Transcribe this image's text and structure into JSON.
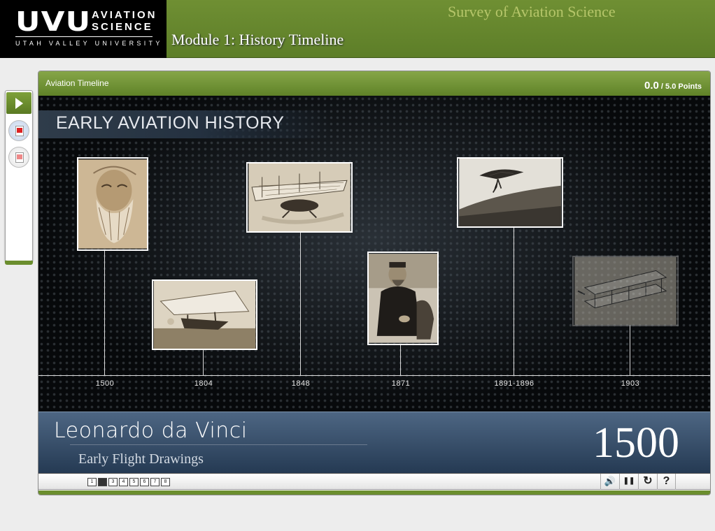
{
  "header": {
    "logo_mark": "UVU",
    "logo_line1": "AVIATION",
    "logo_line2": "SCIENCE",
    "logo_university": "UTAH VALLEY UNIVERSITY",
    "course_title": "Survey of Aviation Science",
    "module_title": "Module 1: History Timeline"
  },
  "sidebar": {
    "items": [
      {
        "icon": "play-icon",
        "state": "default"
      },
      {
        "icon": "pdf-document-icon",
        "state": "active"
      },
      {
        "icon": "pdf-document-icon",
        "state": "inactive"
      }
    ]
  },
  "panel": {
    "title": "Aviation Timeline",
    "score": "0.0",
    "score_total": "/ 5.0 Points"
  },
  "stage": {
    "section_title": "EARLY AVIATION HISTORY",
    "events": [
      {
        "year": "1500",
        "image": "Leonardo da Vinci portrait sketch"
      },
      {
        "year": "1804",
        "image": "early glider photograph"
      },
      {
        "year": "1848",
        "image": "steam-powered aircraft illustration"
      },
      {
        "year": "1871",
        "image": "portrait of seated bearded man"
      },
      {
        "year": "1891-1896",
        "image": "hang glider in flight"
      },
      {
        "year": "1903",
        "image": "biplane glider"
      }
    ]
  },
  "caption": {
    "name": "Leonardo da Vinci",
    "subtitle": "Early Flight Drawings",
    "year": "1500"
  },
  "controls": {
    "pages": [
      "1",
      "2",
      "3",
      "4",
      "5",
      "6",
      "7",
      "8"
    ],
    "current_page": 2,
    "buttons": [
      {
        "name": "volume-icon",
        "glyph": "🔊"
      },
      {
        "name": "pause-icon",
        "glyph": "❚❚"
      },
      {
        "name": "replay-icon",
        "glyph": "↻"
      },
      {
        "name": "help-icon",
        "glyph": "?"
      }
    ]
  },
  "colors": {
    "header_green": "#5d7e28",
    "course_title_gold": "#b6c66a",
    "caption_blue": "#253a53"
  }
}
